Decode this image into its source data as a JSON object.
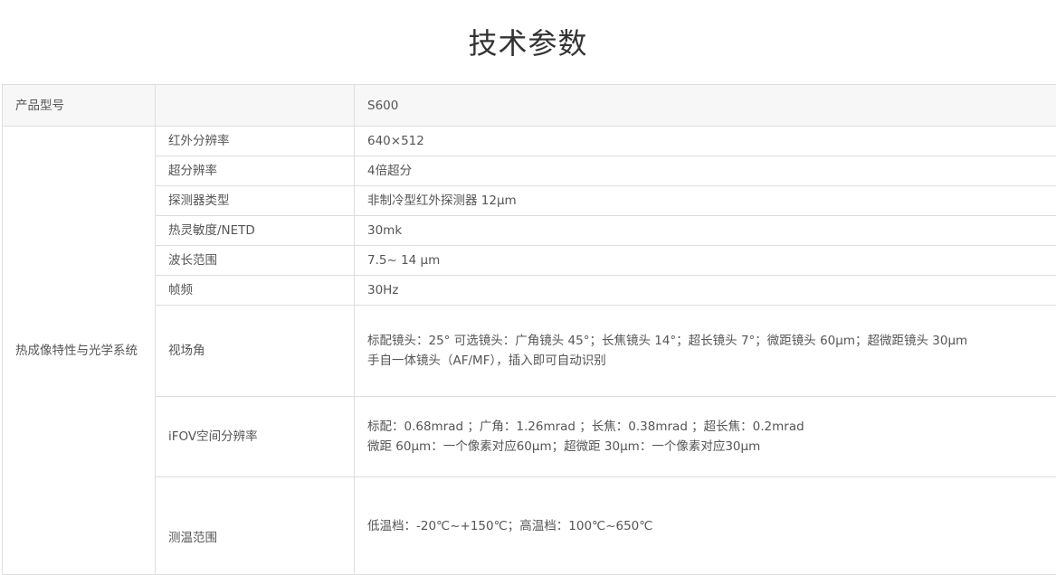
{
  "page": {
    "title": "技术参数"
  },
  "table": {
    "model": {
      "label": "产品型号",
      "sub": "",
      "value": "S600"
    },
    "group": "热成像特性与光学系统",
    "rows": [
      {
        "label": "红外分辨率",
        "lines": [
          "640×512"
        ]
      },
      {
        "label": "超分辨率",
        "lines": [
          "4倍超分"
        ]
      },
      {
        "label": "探测器类型",
        "lines": [
          "非制冷型红外探测器 12μm"
        ]
      },
      {
        "label": "热灵敏度/NETD",
        "lines": [
          "30mk"
        ]
      },
      {
        "label": "波长范围",
        "lines": [
          "7.5~ 14 μm"
        ]
      },
      {
        "label": "帧频",
        "lines": [
          "30Hz"
        ]
      },
      {
        "label": "视场角",
        "lines": [
          "标配镜头：25° 可选镜头：广角镜头 45°；长焦镜头 14°；超长镜头 7°；微距镜头   60μm；超微距镜头 30μm",
          "手自一体镜头（AF/MF），插入即可自动识别"
        ]
      },
      {
        "label": "iFOV空间分辨率",
        "lines": [
          "标配：0.68mrad    ；广角：1.26mrad  ；长焦：0.38mrad  ；超长焦：0.2mrad",
          "微距 60μm：一个像素对应60μm；超微距 30μm：一个像素对应30μm"
        ]
      },
      {
        "label": "测温范围",
        "lines": [
          "低温档：-20℃~+150℃；高温档：100℃~650℃"
        ]
      }
    ]
  }
}
